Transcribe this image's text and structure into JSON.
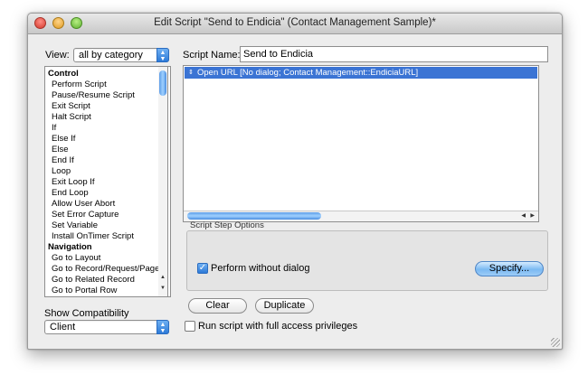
{
  "window": {
    "title": "Edit Script \"Send to Endicia\" (Contact Management Sample)*"
  },
  "view": {
    "label": "View:",
    "selected": "all by category"
  },
  "script_name": {
    "label": "Script Name:",
    "value": "Send to Endicia"
  },
  "commands": [
    {
      "label": "Control",
      "kind": "cat"
    },
    {
      "label": "Perform Script",
      "kind": "item"
    },
    {
      "label": "Pause/Resume Script",
      "kind": "item"
    },
    {
      "label": "Exit Script",
      "kind": "item"
    },
    {
      "label": "Halt Script",
      "kind": "item"
    },
    {
      "label": "If",
      "kind": "item"
    },
    {
      "label": "Else If",
      "kind": "item"
    },
    {
      "label": "Else",
      "kind": "item"
    },
    {
      "label": "End If",
      "kind": "item"
    },
    {
      "label": "Loop",
      "kind": "item"
    },
    {
      "label": "Exit Loop If",
      "kind": "item"
    },
    {
      "label": "End Loop",
      "kind": "item"
    },
    {
      "label": "Allow User Abort",
      "kind": "item"
    },
    {
      "label": "Set Error Capture",
      "kind": "item"
    },
    {
      "label": "Set Variable",
      "kind": "item"
    },
    {
      "label": "Install OnTimer Script",
      "kind": "item"
    },
    {
      "label": "Navigation",
      "kind": "cat"
    },
    {
      "label": "Go to Layout",
      "kind": "item"
    },
    {
      "label": "Go to Record/Request/Page",
      "kind": "item"
    },
    {
      "label": "Go to Related Record",
      "kind": "item"
    },
    {
      "label": "Go to Portal Row",
      "kind": "item"
    }
  ],
  "steps": [
    "Open URL [No dialog; Contact Management::EndiciaURL]"
  ],
  "options": {
    "title": "Script Step Options",
    "perform_without_dialog": "Perform without dialog",
    "perform_checked": true,
    "specify": "Specify..."
  },
  "buttons": {
    "clear": "Clear",
    "duplicate": "Duplicate"
  },
  "full_access": {
    "label": "Run script with full access privileges",
    "checked": false
  },
  "compat": {
    "label": "Show Compatibility",
    "selected": "Client"
  },
  "icons": {
    "up": "▲",
    "down": "▼",
    "left": "◀",
    "right": "▶",
    "grip": "⇕",
    "check": "✓"
  }
}
